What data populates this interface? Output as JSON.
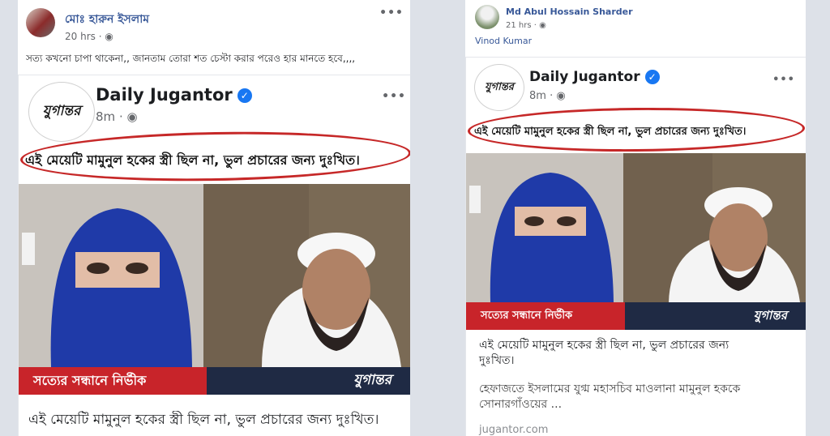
{
  "left_post": {
    "author": "মোঃ হারুন ইসলাম",
    "time": "20 hrs",
    "text": "সত্য কখনো চাপা থাকেনা,, জানতাম তোরা শত চেস্টা করার পরেও হার মানতে হবে,,,,",
    "menu": "•••"
  },
  "right_post": {
    "author": "Md Abul Hossain Sharder",
    "time": "21 hrs",
    "tag": "Vinod Kumar",
    "menu": "•••"
  },
  "shared_post": {
    "page_name": "Daily Jugantor",
    "verified_mark": "✓",
    "time": "8m",
    "logo_text": "যুগান্তর",
    "headline": "এই মেয়েটি মামুনুল হকের স্ত্রী ছিল না, ভুল প্রচারের জন্য দুঃখিত।",
    "menu": "•••",
    "banner_left": "সত্যের সন্ধানে নির্ভীক",
    "banner_right": "যুগান্তর",
    "caption_title": "এই মেয়েটি মামুনুল হকের স্ত্রী ছিল না, ভুল প্রচারের জন্য দুঃখিত।",
    "caption_body": "হেফাজতে ইসলামের যুগ্ম মহাসচিব মাওলানা মামুনুল হককে সোনারগাঁওয়ের ...",
    "url_fragment": "jugantor.com"
  },
  "colors": {
    "background": "#dde1e8",
    "highlight_oval": "#c62828",
    "banner_red": "#c8242a",
    "banner_dark": "#1f2a44",
    "verified_blue": "#1877f2",
    "niqab_blue": "#1f3aa8"
  }
}
